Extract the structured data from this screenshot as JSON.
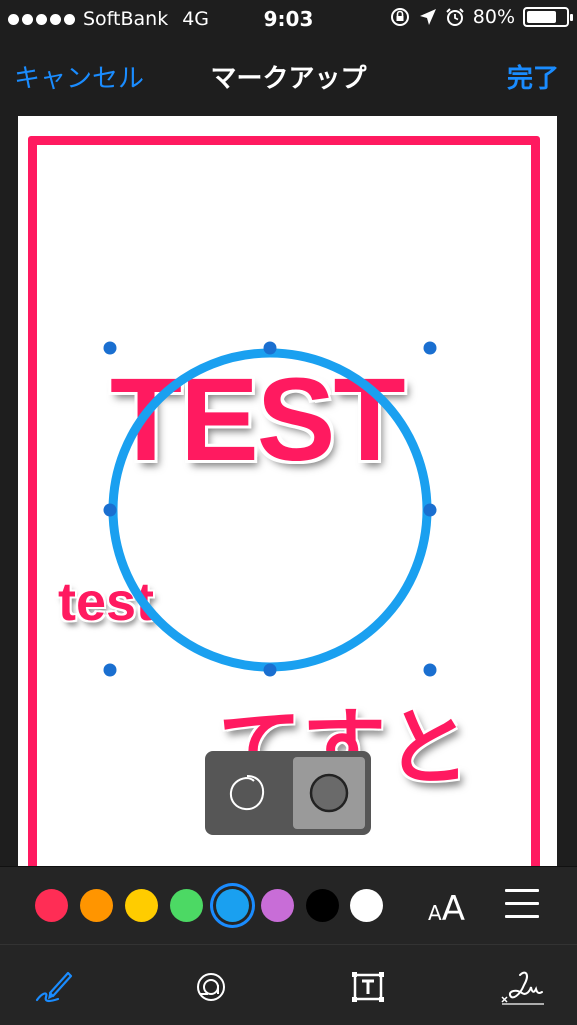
{
  "status_bar": {
    "carrier": "SoftBank",
    "network": "4G",
    "time": "9:03",
    "battery_percent": "80%",
    "battery_level": 0.8
  },
  "nav": {
    "cancel_label": "キャンセル",
    "title": "マークアップ",
    "done_label": "完了"
  },
  "canvas": {
    "text_big": "TEST",
    "text_small": "test",
    "text_jp": "てすと",
    "annotation_color": "#1aa0f0",
    "frame_color": "#ff1a60",
    "text_color": "#ff1a60"
  },
  "shape_popup": {
    "options": [
      "outline-circle-icon",
      "filled-circle-icon"
    ],
    "selected": "filled-circle-icon"
  },
  "color_palette": {
    "colors": [
      "#ff2d55",
      "#ff9500",
      "#ffcc00",
      "#4cd964",
      "#1aa0f0",
      "#c86dd7",
      "#000000",
      "#ffffff"
    ],
    "selected_index": 4,
    "font_size_small": "A",
    "font_size_big": "A"
  },
  "tools": [
    "pen-icon",
    "magnifier-icon",
    "text-box-icon",
    "signature-icon"
  ],
  "active_tool": "pen-icon"
}
